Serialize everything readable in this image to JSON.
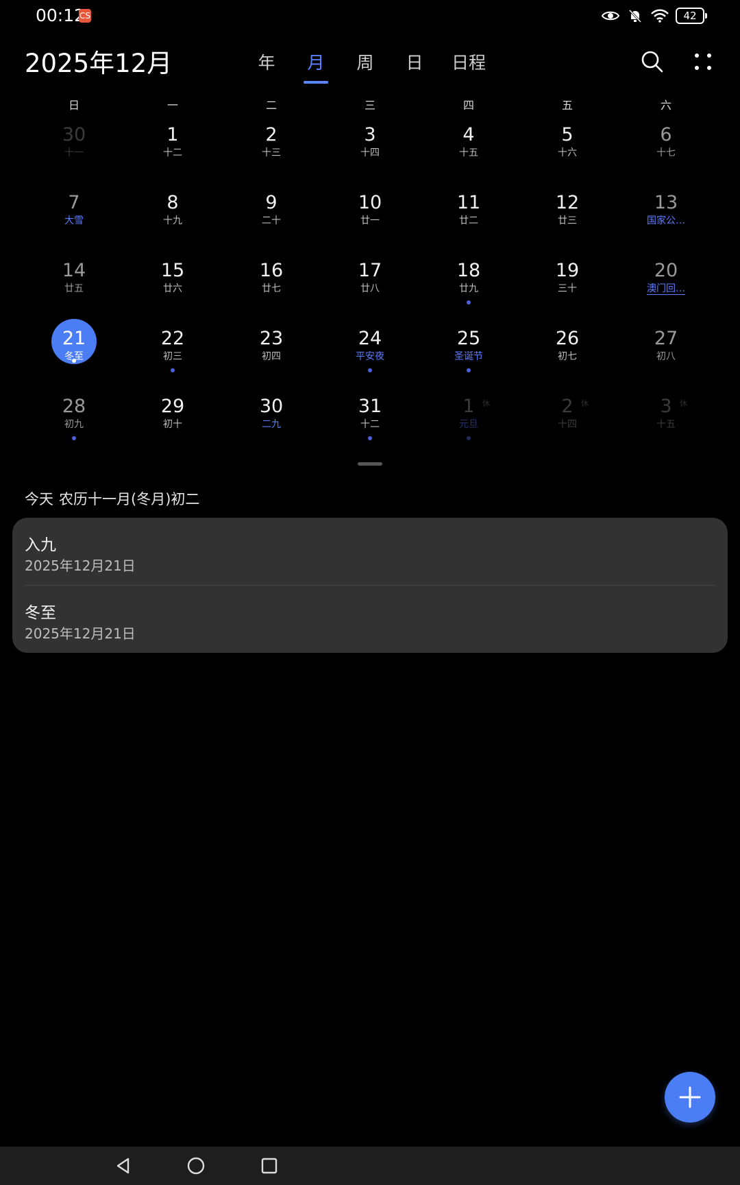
{
  "status_bar": {
    "time": "00:12",
    "notification_badge": "CS",
    "battery": "42"
  },
  "header": {
    "title": "2025年12月",
    "tabs": [
      {
        "label": "年",
        "active": false
      },
      {
        "label": "月",
        "active": true
      },
      {
        "label": "周",
        "active": false
      },
      {
        "label": "日",
        "active": false
      },
      {
        "label": "日程",
        "active": false
      }
    ]
  },
  "calendar": {
    "weekdays": [
      "日",
      "一",
      "二",
      "三",
      "四",
      "五",
      "六"
    ],
    "weeks": [
      [
        {
          "day": "30",
          "lunar": "十一",
          "state": "dim"
        },
        {
          "day": "1",
          "lunar": "十二"
        },
        {
          "day": "2",
          "lunar": "十三"
        },
        {
          "day": "3",
          "lunar": "十四"
        },
        {
          "day": "4",
          "lunar": "十五"
        },
        {
          "day": "5",
          "lunar": "十六"
        },
        {
          "day": "6",
          "lunar": "十七"
        }
      ],
      [
        {
          "day": "7",
          "lunar": "大雪",
          "festival": true
        },
        {
          "day": "8",
          "lunar": "十九"
        },
        {
          "day": "9",
          "lunar": "二十"
        },
        {
          "day": "10",
          "lunar": "廿一"
        },
        {
          "day": "11",
          "lunar": "廿二"
        },
        {
          "day": "12",
          "lunar": "廿三"
        },
        {
          "day": "13",
          "lunar": "国家公…",
          "festival": true
        }
      ],
      [
        {
          "day": "14",
          "lunar": "廿五"
        },
        {
          "day": "15",
          "lunar": "廿六"
        },
        {
          "day": "16",
          "lunar": "廿七"
        },
        {
          "day": "17",
          "lunar": "廿八"
        },
        {
          "day": "18",
          "lunar": "廿九",
          "dot": true
        },
        {
          "day": "19",
          "lunar": "三十"
        },
        {
          "day": "20",
          "lunar": "澳门回…",
          "festival": true,
          "underline": true
        }
      ],
      [
        {
          "day": "21",
          "lunar": "冬至",
          "today": true,
          "dot": true
        },
        {
          "day": "22",
          "lunar": "初三",
          "dot": true
        },
        {
          "day": "23",
          "lunar": "初四"
        },
        {
          "day": "24",
          "lunar": "平安夜",
          "festival": true,
          "dot": true
        },
        {
          "day": "25",
          "lunar": "圣诞节",
          "festival": true,
          "dot": true
        },
        {
          "day": "26",
          "lunar": "初七"
        },
        {
          "day": "27",
          "lunar": "初八"
        }
      ],
      [
        {
          "day": "28",
          "lunar": "初九",
          "dot": true
        },
        {
          "day": "29",
          "lunar": "初十"
        },
        {
          "day": "30",
          "lunar": "二九",
          "festival": true
        },
        {
          "day": "31",
          "lunar": "十二",
          "dot": true
        },
        {
          "day": "1",
          "lunar": "元旦",
          "state": "dim",
          "festival": true,
          "dot": true,
          "tag": "休"
        },
        {
          "day": "2",
          "lunar": "十四",
          "state": "dim",
          "tag": "休"
        },
        {
          "day": "3",
          "lunar": "十五",
          "state": "dim",
          "tag": "休"
        }
      ]
    ]
  },
  "today_summary": {
    "label": "今天",
    "lunar_date": "农历十一月(冬月)初二"
  },
  "events": [
    {
      "title": "入九",
      "date": "2025年12月21日"
    },
    {
      "title": "冬至",
      "date": "2025年12月21日"
    }
  ],
  "colors": {
    "accent": "#4b7ef5",
    "festival": "#5b7cff",
    "card": "#323232"
  },
  "icons": {
    "search": "search-icon",
    "more": "more-icon",
    "add": "plus-icon",
    "back": "back-triangle-icon",
    "home": "home-circle-icon",
    "recents": "recents-square-icon"
  }
}
